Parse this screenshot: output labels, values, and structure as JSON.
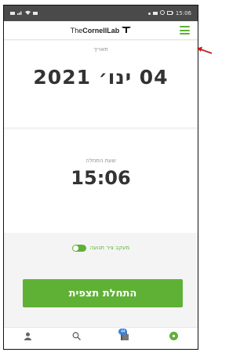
{
  "status_bar": {
    "time": "15:06"
  },
  "header": {
    "logo_light": "The",
    "logo_bold": "CornellLab"
  },
  "date": {
    "label": "תאריך",
    "value": "04 ינו׳ 2021"
  },
  "start_time": {
    "label": "שעת התחלה",
    "value": "15:06"
  },
  "tracking": {
    "label": "מעקב ציר תנועה",
    "enabled": true
  },
  "start_button": {
    "label": "התחלת תצפית"
  },
  "bottom_nav": {
    "badge_count": "44",
    "items": [
      {
        "icon": "user-icon"
      },
      {
        "icon": "search-icon"
      },
      {
        "icon": "checklist-icon"
      },
      {
        "icon": "add-observation-icon"
      }
    ]
  },
  "colors": {
    "accent": "#5fb136",
    "annotation_arrow": "#c81e1e",
    "badge": "#3b82d6"
  }
}
